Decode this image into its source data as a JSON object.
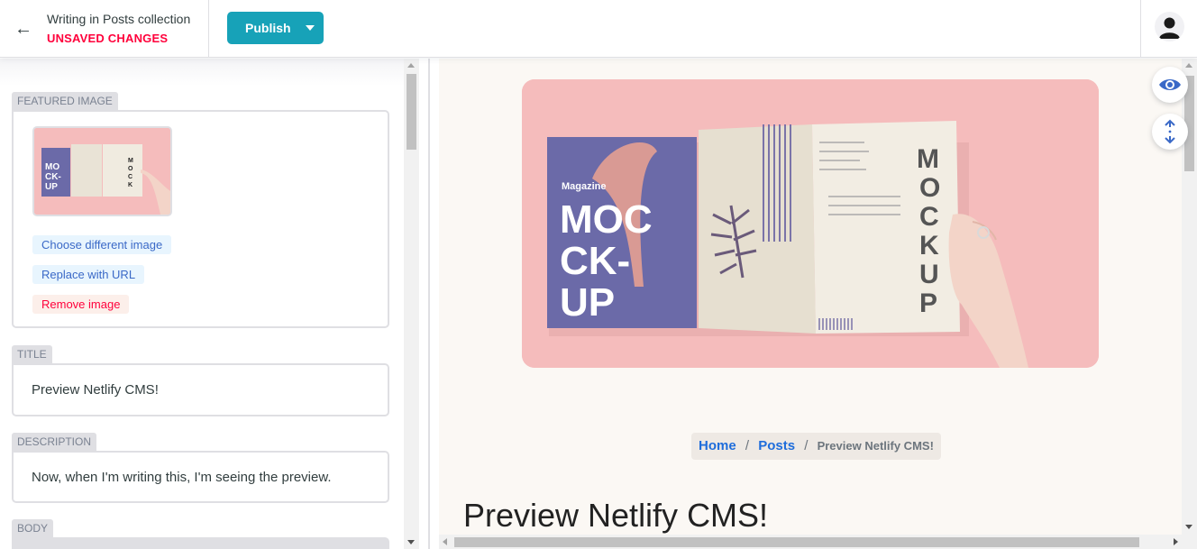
{
  "header": {
    "collection_label": "Writing in Posts collection",
    "status": "UNSAVED CHANGES",
    "publish_label": "Publish"
  },
  "editor": {
    "featured_image": {
      "label": "FEATURED IMAGE",
      "choose_label": "Choose different image",
      "replace_label": "Replace with URL",
      "remove_label": "Remove image"
    },
    "title": {
      "label": "TITLE",
      "value": "Preview Netlify CMS!"
    },
    "description": {
      "label": "DESCRIPTION",
      "value": "Now, when I'm writing this, I'm seeing the preview."
    },
    "body": {
      "label": "BODY"
    }
  },
  "preview": {
    "image": {
      "magazine_word": "Magazine",
      "cover_line1": "MOC",
      "cover_line2": "CK-",
      "cover_line3": "UP",
      "page_vertical": "MOCKUP"
    },
    "breadcrumb": {
      "home": "Home",
      "posts": "Posts",
      "current": "Preview Netlify CMS!",
      "separator": "/"
    },
    "title": "Preview Netlify CMS!"
  },
  "icons": {
    "back": "back-arrow-icon",
    "preview_toggle": "eye-icon",
    "sync_scroll": "vertical-arrows-icon",
    "avatar": "user-icon"
  },
  "colors": {
    "accent": "#17a2b8",
    "unsaved": "#ff003b",
    "link": "#1f6ddb",
    "hero_bg": "#f5bcbc"
  }
}
